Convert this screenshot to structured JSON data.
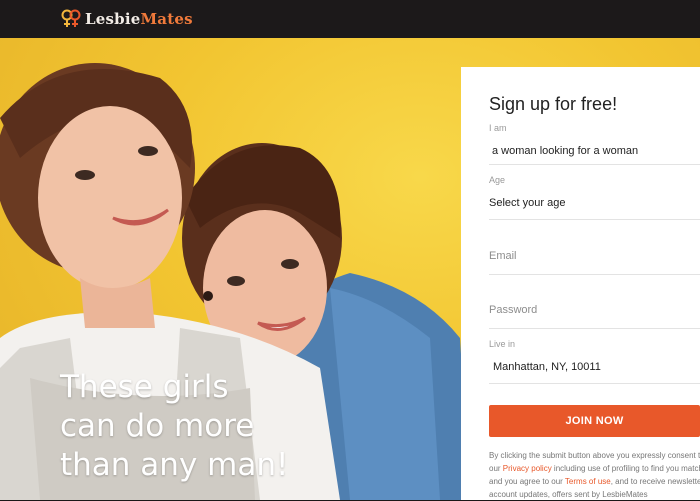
{
  "header": {
    "logo_text_main": "Lesbie",
    "logo_text_accent": "Mates",
    "logo_icon": "female-symbols-icon"
  },
  "hero": {
    "tagline": [
      "These girls",
      "can do more",
      "than any man!"
    ]
  },
  "signup": {
    "title": "Sign up for free!",
    "i_am_label": "I am",
    "i_am_value": "a woman looking for a woman",
    "age_label": "Age",
    "age_value": "Select your age",
    "email_placeholder": "Email",
    "password_placeholder": "Password",
    "live_in_label": "Live in",
    "live_in_value": "Manhattan, NY, 10011",
    "join_label": "JOIN NOW",
    "legal": {
      "line1": "By clicking the submit button above you expressly consent to",
      "line2_pre": "our ",
      "privacy_link": "Privacy policy",
      "line2_post": " including use of profiling to find you matches",
      "line3_pre": "and you agree to our ",
      "terms_link": "Terms of use",
      "line3_post": ", and to receive newsletters,",
      "line4": "account updates, offers sent by LesbieMates"
    }
  },
  "colors": {
    "accent": "#e8582a",
    "background_yellow": "#f2c531",
    "header_bg": "#1c191a"
  }
}
